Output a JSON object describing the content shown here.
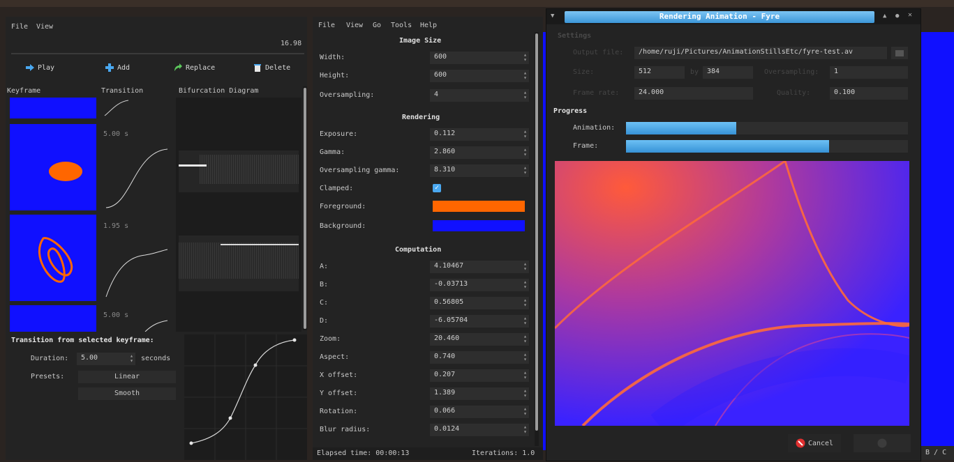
{
  "left_window": {
    "menu": [
      "File",
      "View"
    ],
    "time_value": "16.98",
    "toolbar": {
      "play_label": "Play",
      "add_label": "Add",
      "replace_label": "Replace",
      "delete_label": "Delete"
    },
    "columns": {
      "keyframe": "Keyframe",
      "transition": "Transition",
      "bifurcation": "Bifurcation Diagram"
    },
    "transitions": [
      "5.00 s",
      "1.95 s",
      "5.00 s"
    ],
    "transition_section": {
      "title": "Transition from selected keyframe:",
      "duration_label": "Duration:",
      "duration_value": "5.00",
      "duration_unit": "seconds",
      "presets_label": "Presets:",
      "preset_linear": "Linear",
      "preset_smooth": "Smooth"
    }
  },
  "middle_window": {
    "menu": [
      "File",
      "View",
      "Go",
      "Tools",
      "Help"
    ],
    "image_size": {
      "title": "Image Size",
      "width_label": "Width:",
      "width_value": "600",
      "height_label": "Height:",
      "height_value": "600",
      "oversampling_label": "Oversampling:",
      "oversampling_value": "4"
    },
    "rendering": {
      "title": "Rendering",
      "exposure_label": "Exposure:",
      "exposure_value": "0.112",
      "gamma_label": "Gamma:",
      "gamma_value": "2.860",
      "os_gamma_label": "Oversampling gamma:",
      "os_gamma_value": "8.310",
      "clamped_label": "Clamped:",
      "clamped_checked": true,
      "foreground_label": "Foreground:",
      "foreground_color": "#ff6600",
      "background_label": "Background:",
      "background_color": "#1010ff"
    },
    "computation": {
      "title": "Computation",
      "a_label": "A:",
      "a_value": "4.10467",
      "b_label": "B:",
      "b_value": "-0.03713",
      "c_label": "C:",
      "c_value": "0.56805",
      "d_label": "D:",
      "d_value": "-6.05704",
      "zoom_label": "Zoom:",
      "zoom_value": "20.460",
      "aspect_label": "Aspect:",
      "aspect_value": "0.740",
      "xoff_label": "X offset:",
      "xoff_value": "0.207",
      "yoff_label": "Y offset:",
      "yoff_value": "1.389",
      "rotation_label": "Rotation:",
      "rotation_value": "0.066",
      "blur_label": "Blur radius:",
      "blur_value": "0.0124"
    },
    "status": {
      "elapsed": "Elapsed time: 00:00:13",
      "iterations": "Iterations: 1.0"
    }
  },
  "dialog": {
    "title": "Rendering Animation - Fyre",
    "settings_label": "Settings",
    "output_file_label": "Output file:",
    "output_file_value": "/home/ruji/Pictures/AnimationStillsEtc/fyre-test.av",
    "size_label": "Size:",
    "width_value": "512",
    "by_label": "by",
    "height_value": "384",
    "oversampling_label": "Oversampling:",
    "oversampling_value": "1",
    "frame_rate_label": "Frame rate:",
    "frame_rate_value": "24.000",
    "quality_label": "Quality:",
    "quality_value": "0.100",
    "progress_title": "Progress",
    "animation_label": "Animation:",
    "animation_progress": 0.39,
    "frame_label": "Frame:",
    "frame_progress": 0.72,
    "cancel_label": "Cancel"
  },
  "right_edge_text": "B / C"
}
